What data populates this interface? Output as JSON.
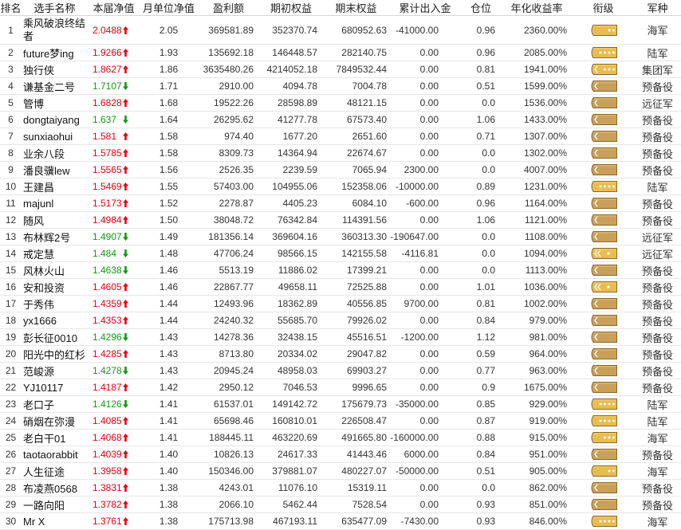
{
  "table": {
    "headers": [
      "排名",
      "选手名称",
      "本届净值",
      "月单位净值",
      "盈利额",
      "期初权益",
      "期末权益",
      "累计出入金",
      "仓位",
      "年化收益率",
      "衔级",
      "军种"
    ],
    "rows": [
      {
        "rank": "1",
        "name": "乘风破浪终结者",
        "nav": "2.0488",
        "trend": "up",
        "month_nav": "2.05",
        "profit": "369581.89",
        "start_equity": "352370.74",
        "end_equity": "680952.63",
        "net_flow": "-41000.00",
        "position": "0.96",
        "annual_return": "2360.00%",
        "insignia": {
          "icon": "rank-insignia-icon",
          "tone": "gold",
          "chevrons": 0,
          "stars": 2
        },
        "branch": "海军"
      },
      {
        "rank": "2",
        "name": "future梦ing",
        "nav": "1.9266",
        "trend": "up",
        "month_nav": "1.93",
        "profit": "135692.18",
        "start_equity": "146448.57",
        "end_equity": "282140.75",
        "net_flow": "0.00",
        "position": "0.96",
        "annual_return": "2085.00%",
        "insignia": {
          "icon": "rank-insignia-icon",
          "tone": "gold",
          "chevrons": 0,
          "stars": 4
        },
        "branch": "陆军"
      },
      {
        "rank": "3",
        "name": "独行侠",
        "nav": "1.8627",
        "trend": "up",
        "month_nav": "1.86",
        "profit": "3635480.26",
        "start_equity": "4214052.18",
        "end_equity": "7849532.44",
        "net_flow": "0.00",
        "position": "0.81",
        "annual_return": "1941.00%",
        "insignia": {
          "icon": "rank-insignia-icon",
          "tone": "gold",
          "chevrons": 1,
          "stars": 3
        },
        "branch": "集团军"
      },
      {
        "rank": "4",
        "name": "谦基金二号",
        "nav": "1.7107",
        "trend": "down",
        "month_nav": "1.71",
        "profit": "2910.00",
        "start_equity": "4094.78",
        "end_equity": "7004.78",
        "net_flow": "0.00",
        "position": "0.51",
        "annual_return": "1599.00%",
        "insignia": {
          "icon": "rank-insignia-icon",
          "tone": "khaki",
          "chevrons": 1,
          "stars": 0
        },
        "branch": "预备役"
      },
      {
        "rank": "5",
        "name": "管博",
        "nav": "1.6828",
        "trend": "up",
        "month_nav": "1.68",
        "profit": "19522.26",
        "start_equity": "28598.89",
        "end_equity": "48121.15",
        "net_flow": "0.00",
        "position": "0.0",
        "annual_return": "1536.00%",
        "insignia": {
          "icon": "rank-insignia-icon",
          "tone": "khaki",
          "chevrons": 1,
          "stars": 0
        },
        "branch": "远征军"
      },
      {
        "rank": "6",
        "name": "dongtaiyang",
        "nav": "1.637",
        "trend": "down",
        "month_nav": "1.64",
        "profit": "26295.62",
        "start_equity": "41277.78",
        "end_equity": "67573.40",
        "net_flow": "0.00",
        "position": "1.06",
        "annual_return": "1433.00%",
        "insignia": {
          "icon": "rank-insignia-icon",
          "tone": "khaki",
          "chevrons": 1,
          "stars": 0
        },
        "branch": "预备役"
      },
      {
        "rank": "7",
        "name": "sunxiaohui",
        "nav": "1.581",
        "trend": "up",
        "month_nav": "1.58",
        "profit": "974.40",
        "start_equity": "1677.20",
        "end_equity": "2651.60",
        "net_flow": "0.00",
        "position": "0.71",
        "annual_return": "1307.00%",
        "insignia": {
          "icon": "rank-insignia-icon",
          "tone": "khaki",
          "chevrons": 1,
          "stars": 0
        },
        "branch": "预备役"
      },
      {
        "rank": "8",
        "name": "业余八段",
        "nav": "1.5785",
        "trend": "up",
        "month_nav": "1.58",
        "profit": "8309.73",
        "start_equity": "14364.94",
        "end_equity": "22674.67",
        "net_flow": "0.00",
        "position": "0.0",
        "annual_return": "1302.00%",
        "insignia": {
          "icon": "rank-insignia-icon",
          "tone": "khaki",
          "chevrons": 1,
          "stars": 0
        },
        "branch": "预备役"
      },
      {
        "rank": "9",
        "name": "潘良骥lew",
        "nav": "1.5565",
        "trend": "up",
        "month_nav": "1.56",
        "profit": "2526.35",
        "start_equity": "2239.59",
        "end_equity": "7065.94",
        "net_flow": "2300.00",
        "position": "0.0",
        "annual_return": "4007.00%",
        "insignia": {
          "icon": "rank-insignia-icon",
          "tone": "khaki",
          "chevrons": 1,
          "stars": 0
        },
        "branch": "预备役"
      },
      {
        "rank": "10",
        "name": "王建昌",
        "nav": "1.5469",
        "trend": "up",
        "month_nav": "1.55",
        "profit": "57403.00",
        "start_equity": "104955.06",
        "end_equity": "152358.06",
        "net_flow": "-10000.00",
        "position": "0.89",
        "annual_return": "1231.00%",
        "insignia": {
          "icon": "rank-insignia-icon",
          "tone": "gold",
          "chevrons": 0,
          "stars": 4
        },
        "branch": "陆军"
      },
      {
        "rank": "11",
        "name": "majunl",
        "nav": "1.5173",
        "trend": "up",
        "month_nav": "1.52",
        "profit": "2278.87",
        "start_equity": "4405.23",
        "end_equity": "6084.10",
        "net_flow": "-600.00",
        "position": "0.96",
        "annual_return": "1164.00%",
        "insignia": {
          "icon": "rank-insignia-icon",
          "tone": "khaki",
          "chevrons": 1,
          "stars": 0
        },
        "branch": "预备役"
      },
      {
        "rank": "12",
        "name": "随风",
        "nav": "1.4984",
        "trend": "up",
        "month_nav": "1.50",
        "profit": "38048.72",
        "start_equity": "76342.84",
        "end_equity": "114391.56",
        "net_flow": "0.00",
        "position": "1.06",
        "annual_return": "1121.00%",
        "insignia": {
          "icon": "rank-insignia-icon",
          "tone": "khaki",
          "chevrons": 1,
          "stars": 0
        },
        "branch": "预备役"
      },
      {
        "rank": "13",
        "name": "布林辉2号",
        "nav": "1.4907",
        "trend": "down",
        "month_nav": "1.49",
        "profit": "181356.14",
        "start_equity": "369604.16",
        "end_equity": "360313.30",
        "net_flow": "-190647.00",
        "position": "0.0",
        "annual_return": "1108.00%",
        "insignia": {
          "icon": "rank-insignia-icon",
          "tone": "khaki",
          "chevrons": 1,
          "stars": 0
        },
        "branch": "远征军"
      },
      {
        "rank": "14",
        "name": "戒定慧",
        "nav": "1.484",
        "trend": "down",
        "month_nav": "1.48",
        "profit": "47706.24",
        "start_equity": "98566.15",
        "end_equity": "142155.58",
        "net_flow": "-4116.81",
        "position": "0.0",
        "annual_return": "1094.00%",
        "insignia": {
          "icon": "rank-insignia-icon",
          "tone": "gold",
          "chevrons": 2,
          "stars": 1
        },
        "branch": "远征军"
      },
      {
        "rank": "15",
        "name": "风林火山",
        "nav": "1.4638",
        "trend": "down",
        "month_nav": "1.46",
        "profit": "5513.19",
        "start_equity": "11886.02",
        "end_equity": "17399.21",
        "net_flow": "0.00",
        "position": "0.0",
        "annual_return": "1113.00%",
        "insignia": {
          "icon": "rank-insignia-icon",
          "tone": "khaki",
          "chevrons": 1,
          "stars": 0
        },
        "branch": "预备役"
      },
      {
        "rank": "16",
        "name": "安和投资",
        "nav": "1.4605",
        "trend": "up",
        "month_nav": "1.46",
        "profit": "22867.77",
        "start_equity": "49658.11",
        "end_equity": "72525.88",
        "net_flow": "0.00",
        "position": "1.01",
        "annual_return": "1036.00%",
        "insignia": {
          "icon": "rank-insignia-icon",
          "tone": "gold",
          "chevrons": 2,
          "stars": 1
        },
        "branch": "预备役"
      },
      {
        "rank": "17",
        "name": "于秀伟",
        "nav": "1.4359",
        "trend": "up",
        "month_nav": "1.44",
        "profit": "12493.96",
        "start_equity": "18362.89",
        "end_equity": "40556.85",
        "net_flow": "9700.00",
        "position": "0.81",
        "annual_return": "1002.00%",
        "insignia": {
          "icon": "rank-insignia-icon",
          "tone": "khaki",
          "chevrons": 1,
          "stars": 0
        },
        "branch": "预备役"
      },
      {
        "rank": "18",
        "name": "yx1666",
        "nav": "1.4353",
        "trend": "up",
        "month_nav": "1.44",
        "profit": "24240.32",
        "start_equity": "55685.70",
        "end_equity": "79926.02",
        "net_flow": "0.00",
        "position": "0.84",
        "annual_return": "979.00%",
        "insignia": {
          "icon": "rank-insignia-icon",
          "tone": "khaki",
          "chevrons": 1,
          "stars": 0
        },
        "branch": "预备役"
      },
      {
        "rank": "19",
        "name": "彭长征0010",
        "nav": "1.4296",
        "trend": "down",
        "month_nav": "1.43",
        "profit": "14278.36",
        "start_equity": "32438.15",
        "end_equity": "45516.51",
        "net_flow": "-1200.00",
        "position": "1.12",
        "annual_return": "981.00%",
        "insignia": {
          "icon": "rank-insignia-icon",
          "tone": "khaki",
          "chevrons": 1,
          "stars": 0
        },
        "branch": "预备役"
      },
      {
        "rank": "20",
        "name": "阳光中的红杉",
        "nav": "1.4285",
        "trend": "up",
        "month_nav": "1.43",
        "profit": "8713.80",
        "start_equity": "20334.02",
        "end_equity": "29047.82",
        "net_flow": "0.00",
        "position": "0.59",
        "annual_return": "964.00%",
        "insignia": {
          "icon": "rank-insignia-icon",
          "tone": "khaki",
          "chevrons": 1,
          "stars": 0
        },
        "branch": "预备役"
      },
      {
        "rank": "21",
        "name": "范峻源",
        "nav": "1.4278",
        "trend": "down",
        "month_nav": "1.43",
        "profit": "20945.24",
        "start_equity": "48958.03",
        "end_equity": "69903.27",
        "net_flow": "0.00",
        "position": "0.77",
        "annual_return": "963.00%",
        "insignia": {
          "icon": "rank-insignia-icon",
          "tone": "khaki",
          "chevrons": 1,
          "stars": 0
        },
        "branch": "预备役"
      },
      {
        "rank": "22",
        "name": "YJ10117",
        "nav": "1.4187",
        "trend": "up",
        "month_nav": "1.42",
        "profit": "2950.12",
        "start_equity": "7046.53",
        "end_equity": "9996.65",
        "net_flow": "0.00",
        "position": "0.9",
        "annual_return": "1675.00%",
        "insignia": {
          "icon": "rank-insignia-icon",
          "tone": "khaki",
          "chevrons": 1,
          "stars": 0
        },
        "branch": "预备役"
      },
      {
        "rank": "23",
        "name": "老口子",
        "nav": "1.4126",
        "trend": "down",
        "month_nav": "1.41",
        "profit": "61537.01",
        "start_equity": "149142.72",
        "end_equity": "175679.73",
        "net_flow": "-35000.00",
        "position": "0.85",
        "annual_return": "929.00%",
        "insignia": {
          "icon": "rank-insignia-icon",
          "tone": "gold",
          "chevrons": 0,
          "stars": 4
        },
        "branch": "陆军"
      },
      {
        "rank": "24",
        "name": "硝烟在弥漫",
        "nav": "1.4085",
        "trend": "up",
        "month_nav": "1.41",
        "profit": "65698.46",
        "start_equity": "160810.01",
        "end_equity": "226508.47",
        "net_flow": "0.00",
        "position": "0.87",
        "annual_return": "919.00%",
        "insignia": {
          "icon": "rank-insignia-icon",
          "tone": "gold",
          "chevrons": 0,
          "stars": 4
        },
        "branch": "陆军"
      },
      {
        "rank": "25",
        "name": "老白干01",
        "nav": "1.4068",
        "trend": "up",
        "month_nav": "1.41",
        "profit": "188445.11",
        "start_equity": "463220.69",
        "end_equity": "491665.80",
        "net_flow": "-160000.00",
        "position": "0.88",
        "annual_return": "915.00%",
        "insignia": {
          "icon": "rank-insignia-icon",
          "tone": "gold",
          "chevrons": 0,
          "stars": 3
        },
        "branch": "海军"
      },
      {
        "rank": "26",
        "name": "taotaorabbit",
        "nav": "1.4039",
        "trend": "up",
        "month_nav": "1.40",
        "profit": "10826.13",
        "start_equity": "24617.33",
        "end_equity": "41443.46",
        "net_flow": "6000.00",
        "position": "0.84",
        "annual_return": "951.00%",
        "insignia": {
          "icon": "rank-insignia-icon",
          "tone": "khaki",
          "chevrons": 1,
          "stars": 0
        },
        "branch": "预备役"
      },
      {
        "rank": "27",
        "name": "人生征途",
        "nav": "1.3958",
        "trend": "up",
        "month_nav": "1.40",
        "profit": "150346.00",
        "start_equity": "379881.07",
        "end_equity": "480227.07",
        "net_flow": "-50000.00",
        "position": "0.51",
        "annual_return": "905.00%",
        "insignia": {
          "icon": "rank-insignia-icon",
          "tone": "gold",
          "chevrons": 0,
          "stars": 2
        },
        "branch": "海军"
      },
      {
        "rank": "28",
        "name": "布凌燕0568",
        "nav": "1.3831",
        "trend": "up",
        "month_nav": "1.38",
        "profit": "4243.01",
        "start_equity": "11076.10",
        "end_equity": "15319.11",
        "net_flow": "0.00",
        "position": "0.0",
        "annual_return": "862.00%",
        "insignia": {
          "icon": "rank-insignia-icon",
          "tone": "khaki",
          "chevrons": 1,
          "stars": 0
        },
        "branch": "预备役"
      },
      {
        "rank": "29",
        "name": "一路向阳",
        "nav": "1.3782",
        "trend": "up",
        "month_nav": "1.38",
        "profit": "2066.10",
        "start_equity": "5462.44",
        "end_equity": "7528.54",
        "net_flow": "0.00",
        "position": "0.93",
        "annual_return": "851.00%",
        "insignia": {
          "icon": "rank-insignia-icon",
          "tone": "khaki",
          "chevrons": 1,
          "stars": 0
        },
        "branch": "预备役"
      },
      {
        "rank": "30",
        "name": "Mr X",
        "nav": "1.3761",
        "trend": "up",
        "month_nav": "1.38",
        "profit": "175713.98",
        "start_equity": "467193.11",
        "end_equity": "635477.09",
        "net_flow": "-7430.00",
        "position": "0.93",
        "annual_return": "846.00%",
        "insignia": {
          "icon": "rank-insignia-icon",
          "tone": "gold",
          "chevrons": 0,
          "stars": 4
        },
        "branch": "海军"
      }
    ]
  },
  "colors": {
    "up": "#e60012",
    "down": "#119a11",
    "badge_gold": "#e9bc4f",
    "badge_khaki": "#c9a05a",
    "badge_edge": "#8a6a2b",
    "badge_mark": "#ffffff",
    "text": "#333333",
    "row_divider": "#e6e6e6"
  }
}
